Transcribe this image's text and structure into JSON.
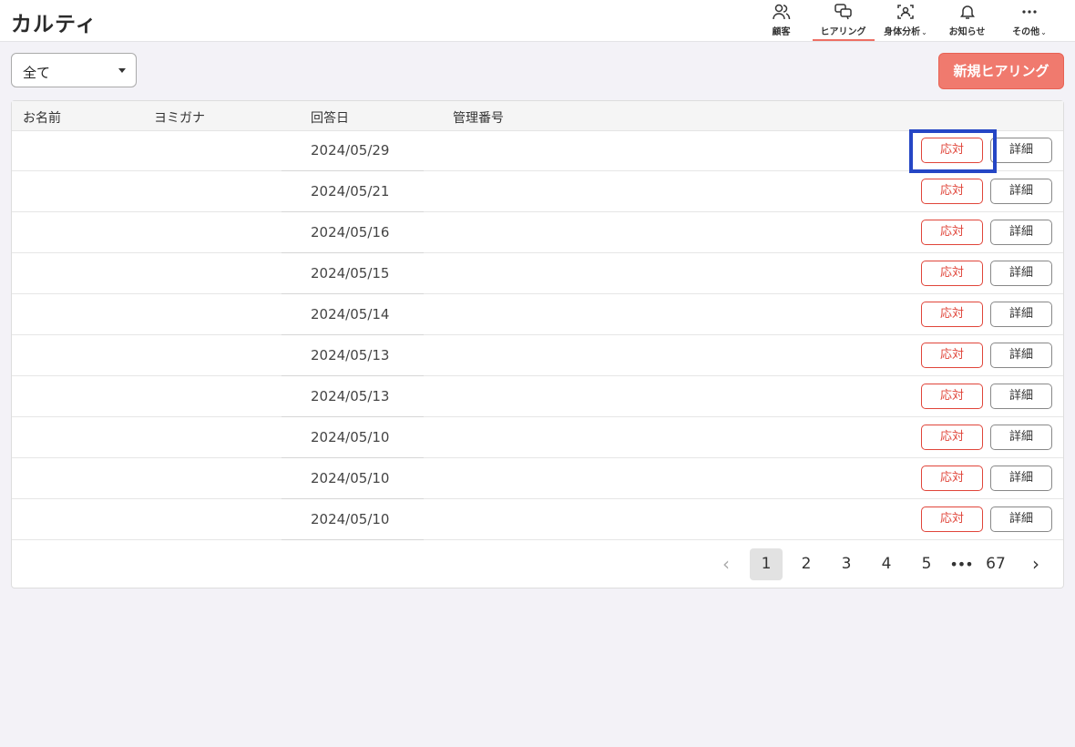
{
  "app": {
    "logo": "カルティ"
  },
  "nav": [
    {
      "label": "顧客",
      "icon": "users-icon",
      "chev": ""
    },
    {
      "label": "ヒアリング",
      "icon": "chat-icon",
      "chev": "",
      "active": true
    },
    {
      "label": "身体分析",
      "icon": "body-scan-icon",
      "chev": "⌄"
    },
    {
      "label": "お知らせ",
      "icon": "bell-icon",
      "chev": ""
    },
    {
      "label": "その他",
      "icon": "more-icon",
      "chev": "⌄"
    }
  ],
  "filter": {
    "value": "全て"
  },
  "new_button": {
    "label": "新規ヒアリング"
  },
  "table": {
    "headers": {
      "name": "お名前",
      "kana": "ヨミガナ",
      "date": "回答日",
      "number": "管理番号"
    },
    "rows": [
      {
        "date": "2024/05/29"
      },
      {
        "date": "2024/05/21"
      },
      {
        "date": "2024/05/16"
      },
      {
        "date": "2024/05/15"
      },
      {
        "date": "2024/05/14"
      },
      {
        "date": "2024/05/13"
      },
      {
        "date": "2024/05/13"
      },
      {
        "date": "2024/05/10"
      },
      {
        "date": "2024/05/10"
      },
      {
        "date": "2024/05/10"
      }
    ],
    "respond_label": "応対",
    "detail_label": "詳細"
  },
  "pagination": {
    "prev": "‹",
    "pages": [
      "1",
      "2",
      "3",
      "4",
      "5"
    ],
    "ellipsis": "•••",
    "last": "67",
    "next": "›",
    "current": "1"
  },
  "colors": {
    "accent": "#f07a6e",
    "respond": "#e0453a",
    "highlight": "#2546c5"
  }
}
